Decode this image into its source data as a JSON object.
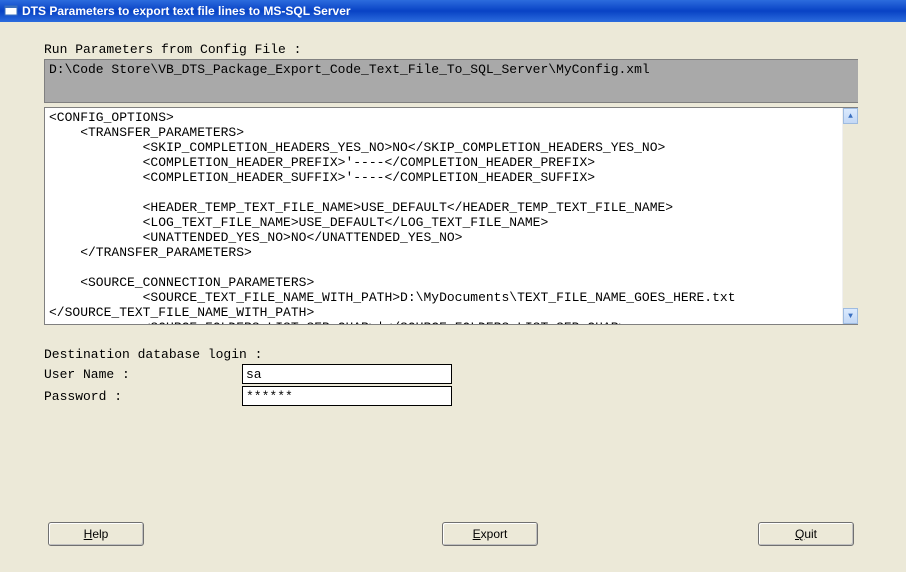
{
  "titlebar": {
    "title": "DTS Parameters to export text file lines to MS-SQL Server"
  },
  "run_params_label": "Run Parameters from Config File :",
  "config_path": "D:\\Code Store\\VB_DTS_Package_Export_Code_Text_File_To_SQL_Server\\MyConfig.xml",
  "config_body": "<CONFIG_OPTIONS>\n    <TRANSFER_PARAMETERS>\n            <SKIP_COMPLETION_HEADERS_YES_NO>NO</SKIP_COMPLETION_HEADERS_YES_NO>\n            <COMPLETION_HEADER_PREFIX>'----</COMPLETION_HEADER_PREFIX>\n            <COMPLETION_HEADER_SUFFIX>'----</COMPLETION_HEADER_SUFFIX>\n\n            <HEADER_TEMP_TEXT_FILE_NAME>USE_DEFAULT</HEADER_TEMP_TEXT_FILE_NAME>\n            <LOG_TEXT_FILE_NAME>USE_DEFAULT</LOG_TEXT_FILE_NAME>\n            <UNATTENDED_YES_NO>NO</UNATTENDED_YES_NO>\n    </TRANSFER_PARAMETERS>\n\n    <SOURCE_CONNECTION_PARAMETERS>\n            <SOURCE_TEXT_FILE_NAME_WITH_PATH>D:\\MyDocuments\\TEXT_FILE_NAME_GOES_HERE.txt\n</SOURCE_TEXT_FILE_NAME_WITH_PATH>\n            <SOURCE_FOLDERS_LIST_SEP_CHAR>|</SOURCE_FOLDERS_LIST_SEP_CHAR>\n            <SOURCE_FOLDERS_LIST>D:\\Project_SaiGrace</SOURCE_FOLDERS_LIST>\n            <SOURCE_FILES_EXCLUSION_LIST_SEP_CHAR>|</SOURCE_FILES_EXCLUSION_LIST_SEP_CHAR>",
  "login": {
    "section_label": "Destination database login :",
    "username_label": "User Name :",
    "username_value": "sa",
    "password_label": "Password :",
    "password_value": "******"
  },
  "buttons": {
    "help": {
      "mnemonic": "H",
      "rest": "elp"
    },
    "export": {
      "mnemonic": "E",
      "rest": "xport"
    },
    "quit": {
      "mnemonic": "Q",
      "rest": "uit"
    }
  }
}
